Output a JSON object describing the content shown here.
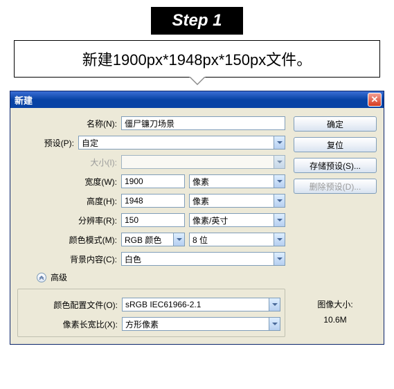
{
  "step": {
    "label": "Step 1"
  },
  "instruction": "新建1900px*1948px*150px文件。",
  "dialog": {
    "title": "新建",
    "labels": {
      "name": "名称(N):",
      "preset": "预设(P):",
      "size": "大小(I):",
      "width": "宽度(W):",
      "height": "高度(H):",
      "resolution": "分辨率(R):",
      "color_mode": "颜色模式(M):",
      "background": "背景内容(C):",
      "advanced": "高级",
      "color_profile": "颜色配置文件(O):",
      "pixel_aspect": "像素长宽比(X):"
    },
    "values": {
      "name": "僵尸镰刀场景",
      "preset": "自定",
      "size": "",
      "width": "1900",
      "width_unit": "像素",
      "height": "1948",
      "height_unit": "像素",
      "resolution": "150",
      "resolution_unit": "像素/英寸",
      "color_mode": "RGB 颜色",
      "color_depth": "8 位",
      "background": "白色",
      "color_profile": "sRGB IEC61966-2.1",
      "pixel_aspect": "方形像素"
    },
    "buttons": {
      "ok": "确定",
      "reset": "复位",
      "save_preset": "存储预设(S)...",
      "delete_preset": "删除预设(D)..."
    },
    "image_size": {
      "label": "图像大小:",
      "value": "10.6M"
    }
  }
}
